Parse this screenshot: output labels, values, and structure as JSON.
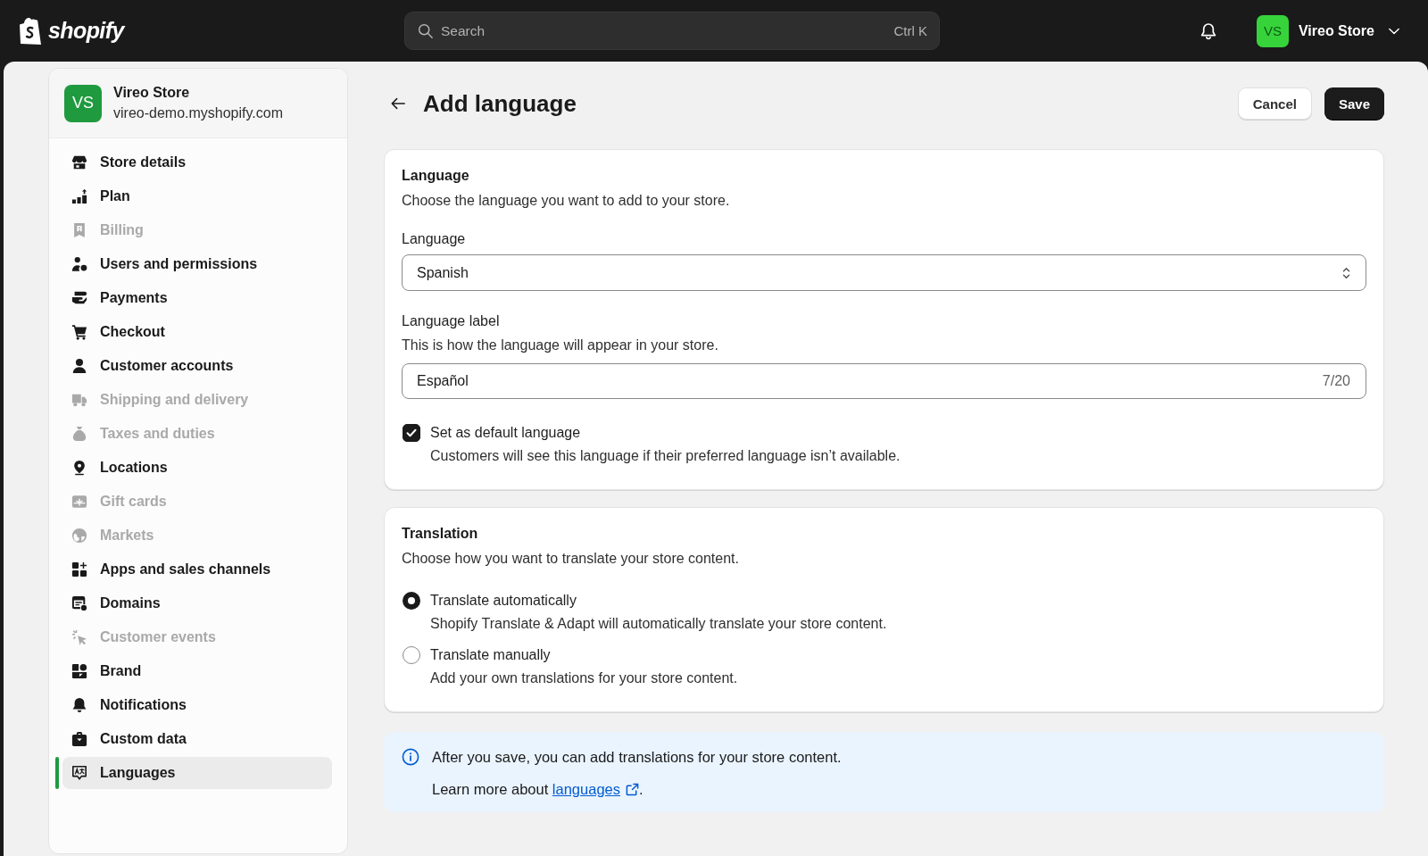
{
  "top_bar": {
    "logo": "shopify",
    "search": {
      "placeholder": "Search",
      "shortcut": "Ctrl K"
    },
    "account": {
      "initials": "VS",
      "name": "Vireo Store"
    }
  },
  "sidebar": {
    "store": {
      "initials": "VS",
      "name": "Vireo Store",
      "domain": "vireo-demo.myshopify.com"
    },
    "items": [
      {
        "label": "Store details",
        "disabled": false,
        "selected": false
      },
      {
        "label": "Plan",
        "disabled": false,
        "selected": false
      },
      {
        "label": "Billing",
        "disabled": true,
        "selected": false
      },
      {
        "label": "Users and permissions",
        "disabled": false,
        "selected": false
      },
      {
        "label": "Payments",
        "disabled": false,
        "selected": false
      },
      {
        "label": "Checkout",
        "disabled": false,
        "selected": false
      },
      {
        "label": "Customer accounts",
        "disabled": false,
        "selected": false
      },
      {
        "label": "Shipping and delivery",
        "disabled": true,
        "selected": false
      },
      {
        "label": "Taxes and duties",
        "disabled": true,
        "selected": false
      },
      {
        "label": "Locations",
        "disabled": false,
        "selected": false
      },
      {
        "label": "Gift cards",
        "disabled": true,
        "selected": false
      },
      {
        "label": "Markets",
        "disabled": true,
        "selected": false
      },
      {
        "label": "Apps and sales channels",
        "disabled": false,
        "selected": false
      },
      {
        "label": "Domains",
        "disabled": false,
        "selected": false
      },
      {
        "label": "Customer events",
        "disabled": true,
        "selected": false
      },
      {
        "label": "Brand",
        "disabled": false,
        "selected": false
      },
      {
        "label": "Notifications",
        "disabled": false,
        "selected": false
      },
      {
        "label": "Custom data",
        "disabled": false,
        "selected": false
      },
      {
        "label": "Languages",
        "disabled": false,
        "selected": true
      }
    ]
  },
  "header": {
    "title": "Add language",
    "actions": [
      {
        "label": "Cancel",
        "kind": "secondary"
      },
      {
        "label": "Save",
        "kind": "primary"
      }
    ]
  },
  "language_card": {
    "title": "Language",
    "description": "Choose the language you want to add to your store.",
    "language_select": {
      "label": "Language",
      "value": "Spanish"
    },
    "label_field": {
      "label": "Language label",
      "help": "This is how the language will appear in your store.",
      "value": "Español",
      "counter": "7/20"
    },
    "default_checkbox": {
      "label": "Set as default language",
      "help": "Customers will see this language if their preferred language isn’t available.",
      "checked": true
    }
  },
  "translation_card": {
    "title": "Translation",
    "description": "Choose how you want to translate your store content.",
    "options": [
      {
        "label": "Translate automatically",
        "help": "Shopify Translate & Adapt will automatically translate your store content.",
        "selected": true
      },
      {
        "label": "Translate manually",
        "help": "Add your own translations for your store content.",
        "selected": false
      }
    ]
  },
  "banner": {
    "message": "After you save, you can add translations for your store content.",
    "learn_more": {
      "before": "Learn more about",
      "link": "languages",
      "after": "."
    }
  }
}
